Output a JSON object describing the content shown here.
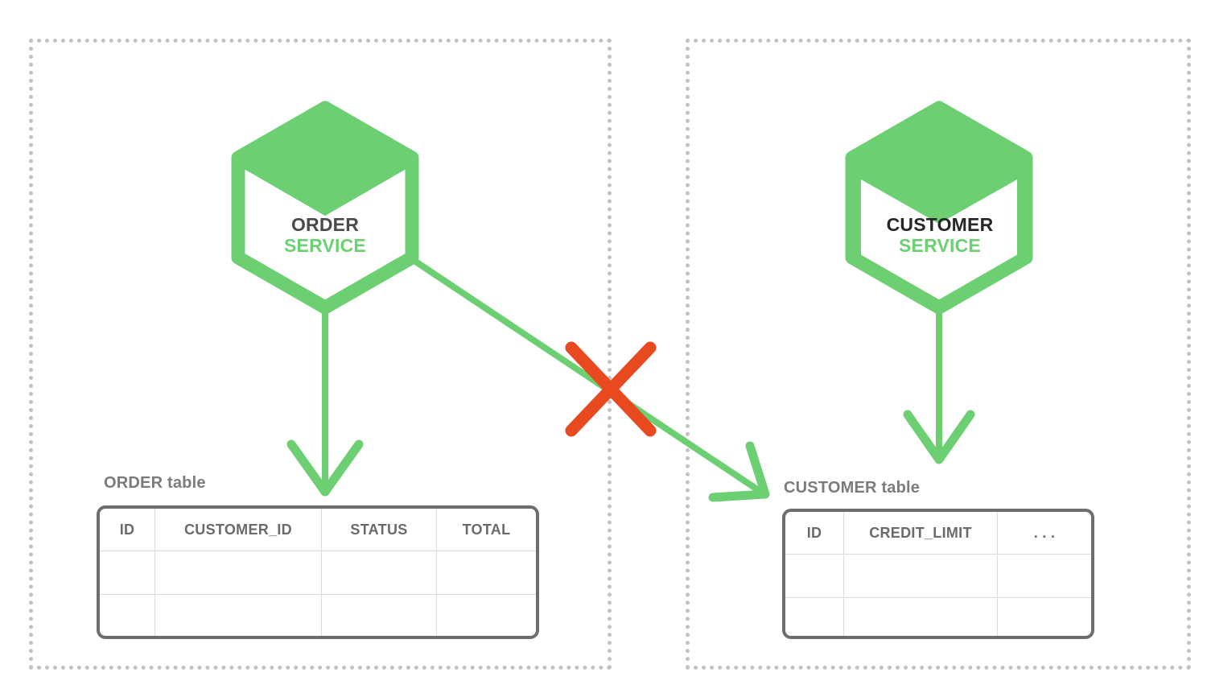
{
  "diagram": {
    "title": "Microservice database-per-service diagram",
    "colors": {
      "green": "#6ccf72",
      "orange": "#e8491f",
      "region_border": "#c2c2c2",
      "table_border": "#6d6d6d",
      "table_grid": "#dcdcdc",
      "caption_gray": "#7b7b7b",
      "header_gray": "#6a6a6a",
      "dark_text": "#262626"
    }
  },
  "regions": [
    {
      "id": "order-region",
      "name": "Order Service boundary"
    },
    {
      "id": "customer-region",
      "name": "Customer Service boundary"
    }
  ],
  "services": [
    {
      "id": "order-service",
      "name_line1": "ORDER",
      "name_line2": "SERVICE",
      "icon": "hexagon-service-icon",
      "filled": false
    },
    {
      "id": "customer-service",
      "name_line1": "CUSTOMER",
      "name_line2": "SERVICE",
      "icon": "hexagon-service-icon",
      "filled": true
    }
  ],
  "tables": [
    {
      "id": "order-table",
      "caption": "ORDER table",
      "columns": [
        "ID",
        "CUSTOMER_ID",
        "STATUS",
        "TOTAL"
      ],
      "rows": [
        [
          "",
          "",
          "",
          ""
        ],
        [
          "",
          "",
          "",
          ""
        ]
      ]
    },
    {
      "id": "customer-table",
      "caption": "CUSTOMER table",
      "columns": [
        "ID",
        "CREDIT_LIMIT",
        ". . ."
      ],
      "rows": [
        [
          "",
          "",
          ""
        ],
        [
          "",
          "",
          ""
        ]
      ]
    }
  ],
  "connectors": [
    {
      "id": "order-to-order-table",
      "name": "order-service-to-order-table-arrow",
      "from": "order-service",
      "to": "order-table",
      "blocked": false
    },
    {
      "id": "order-to-customer-table",
      "name": "order-service-to-customer-table-arrow",
      "from": "order-service",
      "to": "customer-table",
      "blocked": true,
      "blocked_marker": "red-cross-icon"
    },
    {
      "id": "customer-to-customer-table",
      "name": "customer-service-to-customer-table-arrow",
      "from": "customer-service",
      "to": "customer-table",
      "blocked": false
    }
  ]
}
